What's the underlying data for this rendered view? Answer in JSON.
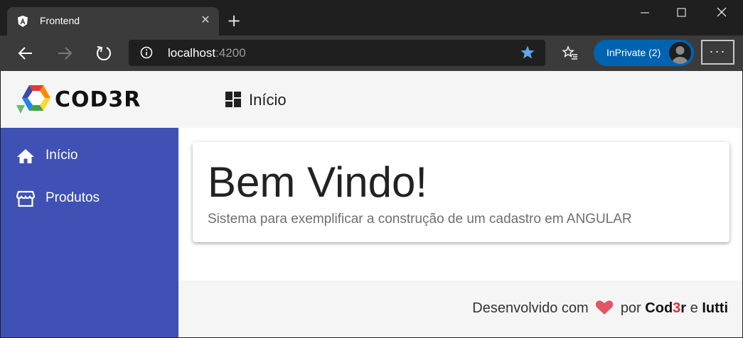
{
  "browser": {
    "tab_title": "Frontend",
    "tab_close": "✕",
    "new_tab": "+",
    "address_host": "localhost",
    "address_port": ":4200",
    "inprivate_label": "InPrivate (2)",
    "more_label": "···",
    "accent_color": "#0063b1"
  },
  "header": {
    "logo_text": "COD3R",
    "title": "Início",
    "icon": "dashboard-icon"
  },
  "sidebar": {
    "color": "#3f51b5",
    "items": [
      {
        "label": "Início",
        "icon": "home-icon"
      },
      {
        "label": "Produtos",
        "icon": "storefront-icon"
      }
    ]
  },
  "card": {
    "title": "Bem Vindo!",
    "subtitle": "Sistema para exemplificar a construção de um cadastro em ANGULAR"
  },
  "footer": {
    "prefix": "Desenvolvido com",
    "middle": "por",
    "brand_a": "Cod",
    "brand_b": "3",
    "brand_c": "r",
    "joiner": "e",
    "author": "Iutti"
  }
}
